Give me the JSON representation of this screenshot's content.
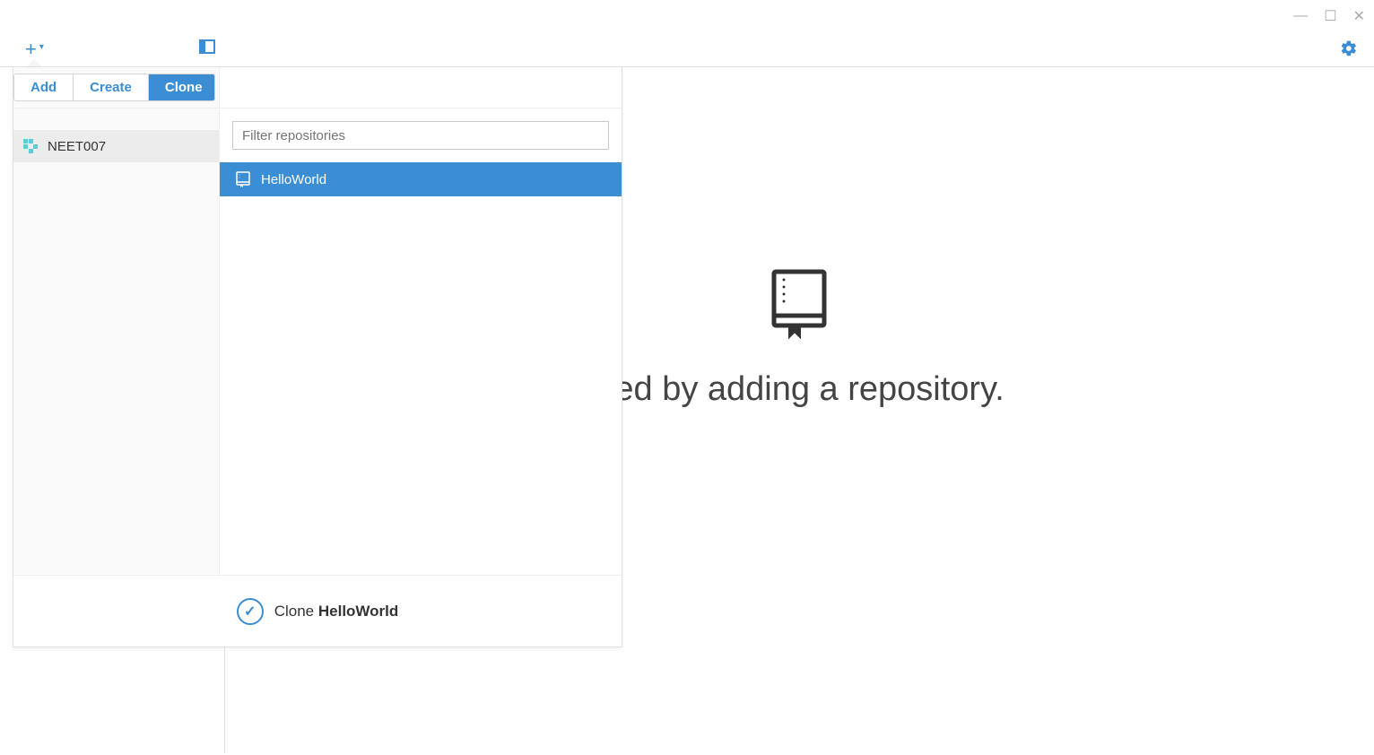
{
  "window": {
    "minimize": "—",
    "maximize": "☐",
    "close": "✕"
  },
  "toolbar": {
    "plus": "+",
    "caret": "▾"
  },
  "dropdown": {
    "tabs": {
      "add": "Add",
      "create": "Create",
      "clone": "Clone"
    },
    "sidebar": {
      "account": "NEET007"
    },
    "filter_placeholder": "Filter repositories",
    "repos": {
      "item0": "HelloWorld"
    },
    "footer": {
      "check": "✓",
      "action": "Clone ",
      "repo": "HelloWorld"
    }
  },
  "empty_state": {
    "text": "rted by adding a repository."
  }
}
